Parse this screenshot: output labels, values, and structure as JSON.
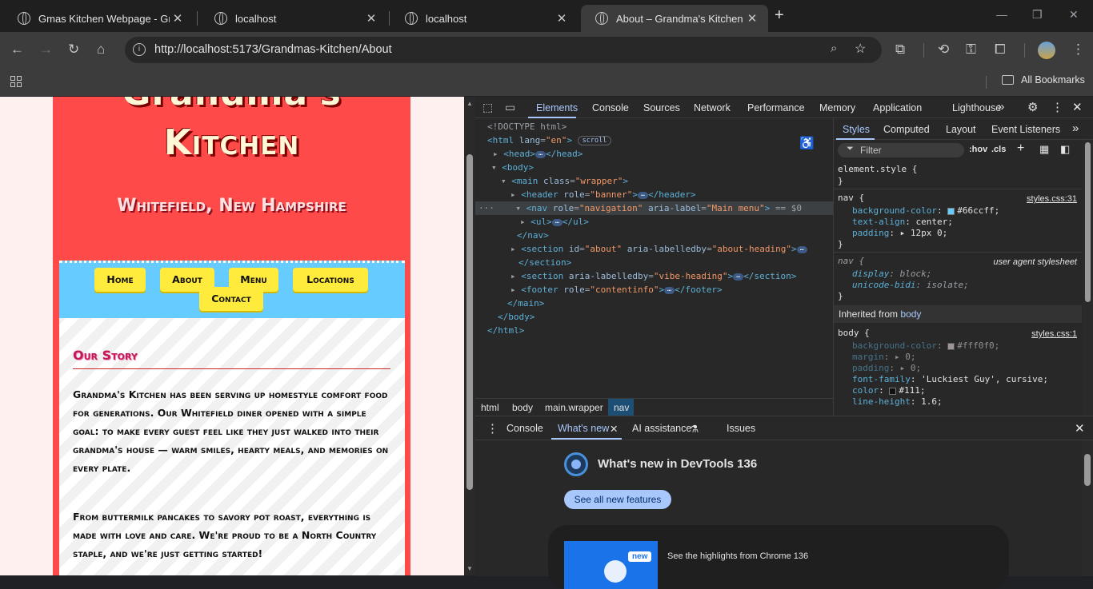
{
  "browser": {
    "tabs": [
      {
        "title": "Gmas Kitchen Webpage - Grandm"
      },
      {
        "title": "localhost"
      },
      {
        "title": "localhost"
      },
      {
        "title": "About – Grandma's Kitchen"
      }
    ],
    "new_tab": "+",
    "url": "http://localhost:5173/Grandmas-Kitchen/About",
    "all_bookmarks": "All Bookmarks"
  },
  "page": {
    "title_line1": "Grandma's",
    "title_line2": "Kitchen",
    "subtitle": "Whitefield, New Hampshire",
    "nav": [
      "Home",
      "About",
      "Menu",
      "Locations",
      "Contact"
    ],
    "heading": "Our Story",
    "para1": "Grandma's Kitchen has been serving up homestyle comfort food for generations. Our Whitefield diner opened with a simple goal: to make every guest feel like they just walked into their grandma's house — warm smiles, hearty meals, and memories on every plate.",
    "para2": "From buttermilk pancakes to savory pot roast, everything is made with love and care. We're proud to be a North Country staple, and we're just getting started!"
  },
  "devtools": {
    "tabs": [
      "Elements",
      "Console",
      "Sources",
      "Network",
      "Performance",
      "Memory",
      "Application",
      "Lighthouse"
    ],
    "dom": {
      "doctype": "<!DOCTYPE html>",
      "html_open": "<html",
      "lang_attr": "lang",
      "lang_val": "\"en\"",
      "scroll_badge": "scroll",
      "head": "<head>",
      "head_close": "</head>",
      "body": "<body>",
      "main": "<main",
      "class_attr": "class",
      "class_val": "\"wrapper\"",
      "header": "<header",
      "role_attr": "role",
      "banner_val": "\"banner\"",
      "header_close": "</header>",
      "nav": "<nav",
      "navigation_val": "\"navigation\"",
      "aria_label_attr": "aria-label",
      "main_menu_val": "\"Main menu\"",
      "dollar0": "== $0",
      "ul": "<ul>",
      "ul_close": "</ul>",
      "nav_close": "</nav>",
      "section": "<section",
      "id_attr": "id",
      "about_val": "\"about\"",
      "labelledby_attr": "aria-labelledby",
      "about_heading_val": "\"about-heading\"",
      "section_close": "</section>",
      "vibe_heading_val": "\"vibe-heading\"",
      "footer": "<footer",
      "contentinfo_val": "\"contentinfo\"",
      "footer_close": "</footer>",
      "main_close": "</main>",
      "body_close": "</body>",
      "html_close": "</html>",
      "dots": "…"
    },
    "breadcrumbs": [
      "html",
      "body",
      "main.wrapper",
      "nav"
    ],
    "styles_tabs": [
      "Styles",
      "Computed",
      "Layout",
      "Event Listeners"
    ],
    "filter_placeholder": "Filter",
    "hov": ":hov",
    "cls": ".cls",
    "styles": {
      "element_style": "element.style {",
      "close": "}",
      "nav_sel": "nav {",
      "nav_src": "styles.css:31",
      "bg_prop": "background-color",
      "bg_val": "#66ccff;",
      "ta_prop": "text-align",
      "ta_val": "center;",
      "pad_prop": "padding",
      "pad_val": "12px 0;",
      "ua_sel": "nav {",
      "ua_src": "user agent stylesheet",
      "display_prop": "display",
      "display_val": "block;",
      "bidi_prop": "unicode-bidi",
      "bidi_val": "isolate;",
      "inherited_from": "Inherited from",
      "inherited_el": "body",
      "body_sel": "body {",
      "body_src": "styles.css:1",
      "body_bg_val": "#fff0f0;",
      "margin_prop": "margin",
      "zero_val": "0;",
      "padding_prop": "padding",
      "ff_prop": "font-family",
      "ff_val": "'Luckiest Guy', cursive;",
      "color_prop": "color",
      "color_val": "#111;",
      "lh_prop": "line-height",
      "lh_val": "1.6;"
    },
    "drawer_tabs": [
      "Console",
      "What's new",
      "AI assistance",
      "Issues"
    ],
    "whats_new_title": "What's new in DevTools 136",
    "see_all": "See all new features",
    "new_badge": "new",
    "highlight_text": "See the highlights from Chrome 136"
  },
  "colors": {
    "nav_bg": "#66ccff",
    "card_bg": "#ff4a4a",
    "page_bg": "#fff0f0",
    "button": "#ffeb3b"
  }
}
